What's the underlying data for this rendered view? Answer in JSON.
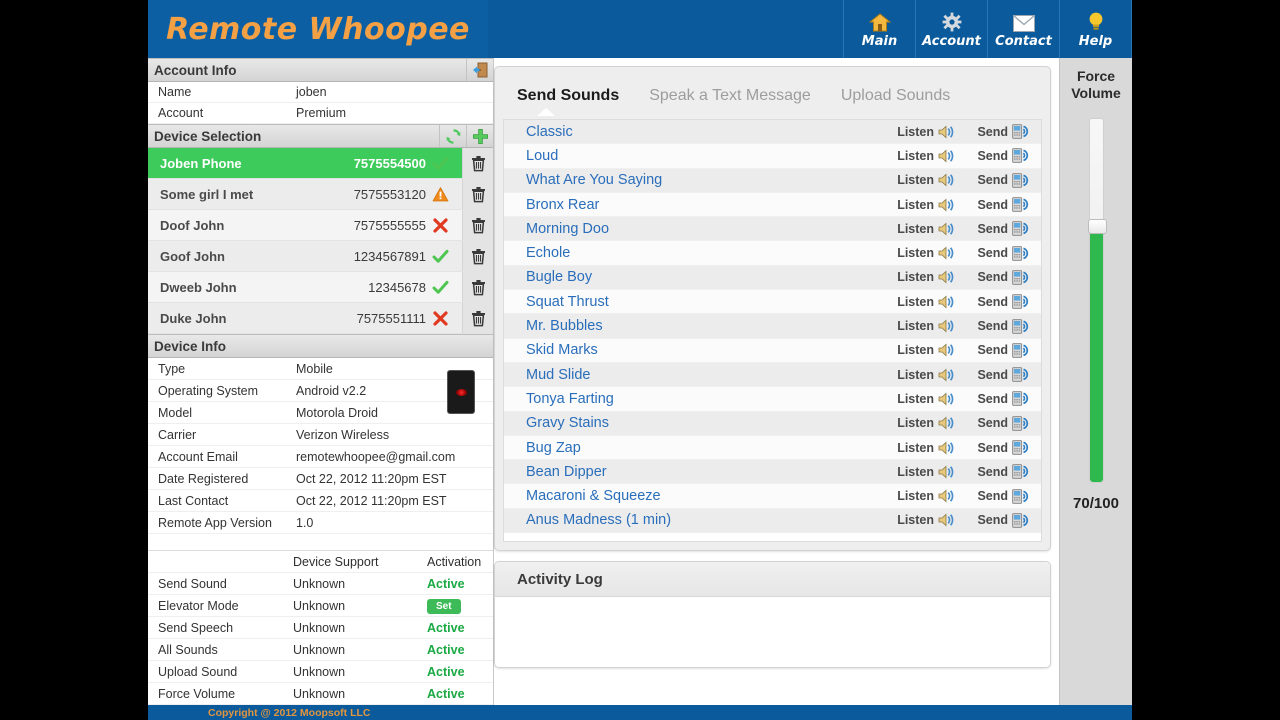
{
  "header": {
    "logo": "Remote Whoopee",
    "nav": [
      {
        "label": "Main",
        "icon": "home-icon"
      },
      {
        "label": "Account",
        "icon": "gear-icon"
      },
      {
        "label": "Contact",
        "icon": "envelope-icon"
      },
      {
        "label": "Help",
        "icon": "lightbulb-icon"
      }
    ]
  },
  "account_info": {
    "title": "Account Info",
    "logout_icon": "logout-door-icon",
    "rows": [
      {
        "key": "Name",
        "value": "joben"
      },
      {
        "key": "Account",
        "value": "Premium"
      }
    ]
  },
  "device_selection": {
    "title": "Device Selection",
    "refresh_icon": "refresh-icon",
    "add_icon": "plus-icon",
    "devices": [
      {
        "name": "Joben Phone",
        "number": "7575554500",
        "status": "check",
        "selected": true
      },
      {
        "name": "Some girl I met",
        "number": "7575553120",
        "status": "warning",
        "selected": false
      },
      {
        "name": "Doof John",
        "number": "7575555555",
        "status": "cross",
        "selected": false
      },
      {
        "name": "Goof John",
        "number": "1234567891",
        "status": "check",
        "selected": false
      },
      {
        "name": "Dweeb John",
        "number": "12345678",
        "status": "check",
        "selected": false
      },
      {
        "name": "Duke John",
        "number": "7575551111",
        "status": "cross",
        "selected": false
      }
    ]
  },
  "device_info": {
    "title": "Device Info",
    "thumbnail": "mobile-phone-thumbnail",
    "rows": [
      {
        "key": "Type",
        "value": "Mobile"
      },
      {
        "key": "Operating System",
        "value": "Android v2.2"
      },
      {
        "key": "Model",
        "value": "Motorola Droid"
      },
      {
        "key": "Carrier",
        "value": "Verizon Wireless"
      },
      {
        "key": "Account Email",
        "value": "remotewhoopee@gmail.com"
      },
      {
        "key": "Date Registered",
        "value": "Oct 22, 2012 11:20pm EST"
      },
      {
        "key": "Last Contact",
        "value": "Oct 22, 2012 11:20pm EST"
      },
      {
        "key": "Remote App Version",
        "value": "1.0"
      }
    ]
  },
  "support_table": {
    "headers": {
      "feature": "",
      "support": "Device Support",
      "activation": "Activation"
    },
    "rows": [
      {
        "feature": "Send Sound",
        "support": "Unknown",
        "activation": "Active",
        "type": "text"
      },
      {
        "feature": "Elevator Mode",
        "support": "Unknown",
        "activation": "Set",
        "type": "button"
      },
      {
        "feature": "Send Speech",
        "support": "Unknown",
        "activation": "Active",
        "type": "text"
      },
      {
        "feature": "All Sounds",
        "support": "Unknown",
        "activation": "Active",
        "type": "text"
      },
      {
        "feature": "Upload Sound",
        "support": "Unknown",
        "activation": "Active",
        "type": "text"
      },
      {
        "feature": "Force Volume",
        "support": "Unknown",
        "activation": "Active",
        "type": "text"
      }
    ]
  },
  "main_panel": {
    "tabs": [
      {
        "label": "Send Sounds",
        "active": true
      },
      {
        "label": "Speak a Text Message",
        "active": false
      },
      {
        "label": "Upload Sounds",
        "active": false
      }
    ],
    "listen_label": "Listen",
    "send_label": "Send",
    "listen_icon": "speaker-icon",
    "send_icon": "send-to-phone-icon",
    "sounds": [
      "Classic",
      "Loud",
      "What Are You Saying",
      "Bronx Rear",
      "Morning Doo",
      "Echole",
      "Bugle Boy",
      "Squat Thrust",
      "Mr. Bubbles",
      "Skid Marks",
      "Mud Slide",
      "Tonya Farting",
      "Gravy Stains",
      "Bug Zap",
      "Bean Dipper",
      "Macaroni & Squeeze",
      "Anus Madness (1 min)"
    ]
  },
  "activity_log": {
    "title": "Activity Log",
    "entries": []
  },
  "force_volume": {
    "title_line1": "Force",
    "title_line2": "Volume",
    "value": "70/100",
    "percent": 70
  },
  "footer": {
    "copyright": "Copyright @ 2012 Moopsoft LLC"
  },
  "colors": {
    "brand_blue": "#0a5a9c",
    "logo_orange": "#f4a044",
    "selected_green": "#3dcc5c",
    "active_green": "#1aa943",
    "link_blue": "#2a6ebb",
    "warning_orange": "#f08a1c",
    "error_red": "#e03a20"
  }
}
